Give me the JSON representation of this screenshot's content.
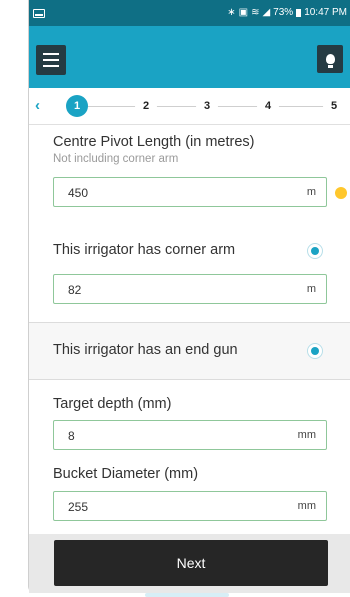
{
  "status_bar": {
    "battery": "73%",
    "time": "10:47 PM"
  },
  "app_bar": {
    "menu_icon": "menu-icon",
    "hint_icon": "lightbulb-icon"
  },
  "stepper": {
    "back_icon": "chevron-left-icon",
    "steps": [
      "1",
      "2",
      "3",
      "4",
      "5"
    ],
    "active_step": "1"
  },
  "form": {
    "pivot_length": {
      "label": "Centre Pivot Length (in metres)",
      "sublabel": "Not including corner arm",
      "value": "450",
      "unit": "m"
    },
    "corner_arm": {
      "label": "This irrigator has corner arm",
      "checked": true,
      "value": "82",
      "unit": "m"
    },
    "end_gun": {
      "label": "This irrigator has an end gun",
      "checked": true
    },
    "target_depth": {
      "label": "Target depth (mm)",
      "value": "8",
      "unit": "mm"
    },
    "bucket_diameter": {
      "label": "Bucket Diameter (mm)",
      "value": "255",
      "unit": "mm"
    }
  },
  "next_label": "Next",
  "colors": {
    "status_bar": "#0f6f85",
    "app_bar": "#1aa3c4",
    "accent": "#1aa3c4",
    "field_border": "#8fc79a",
    "warning": "#ffc72c",
    "button": "#262626"
  }
}
